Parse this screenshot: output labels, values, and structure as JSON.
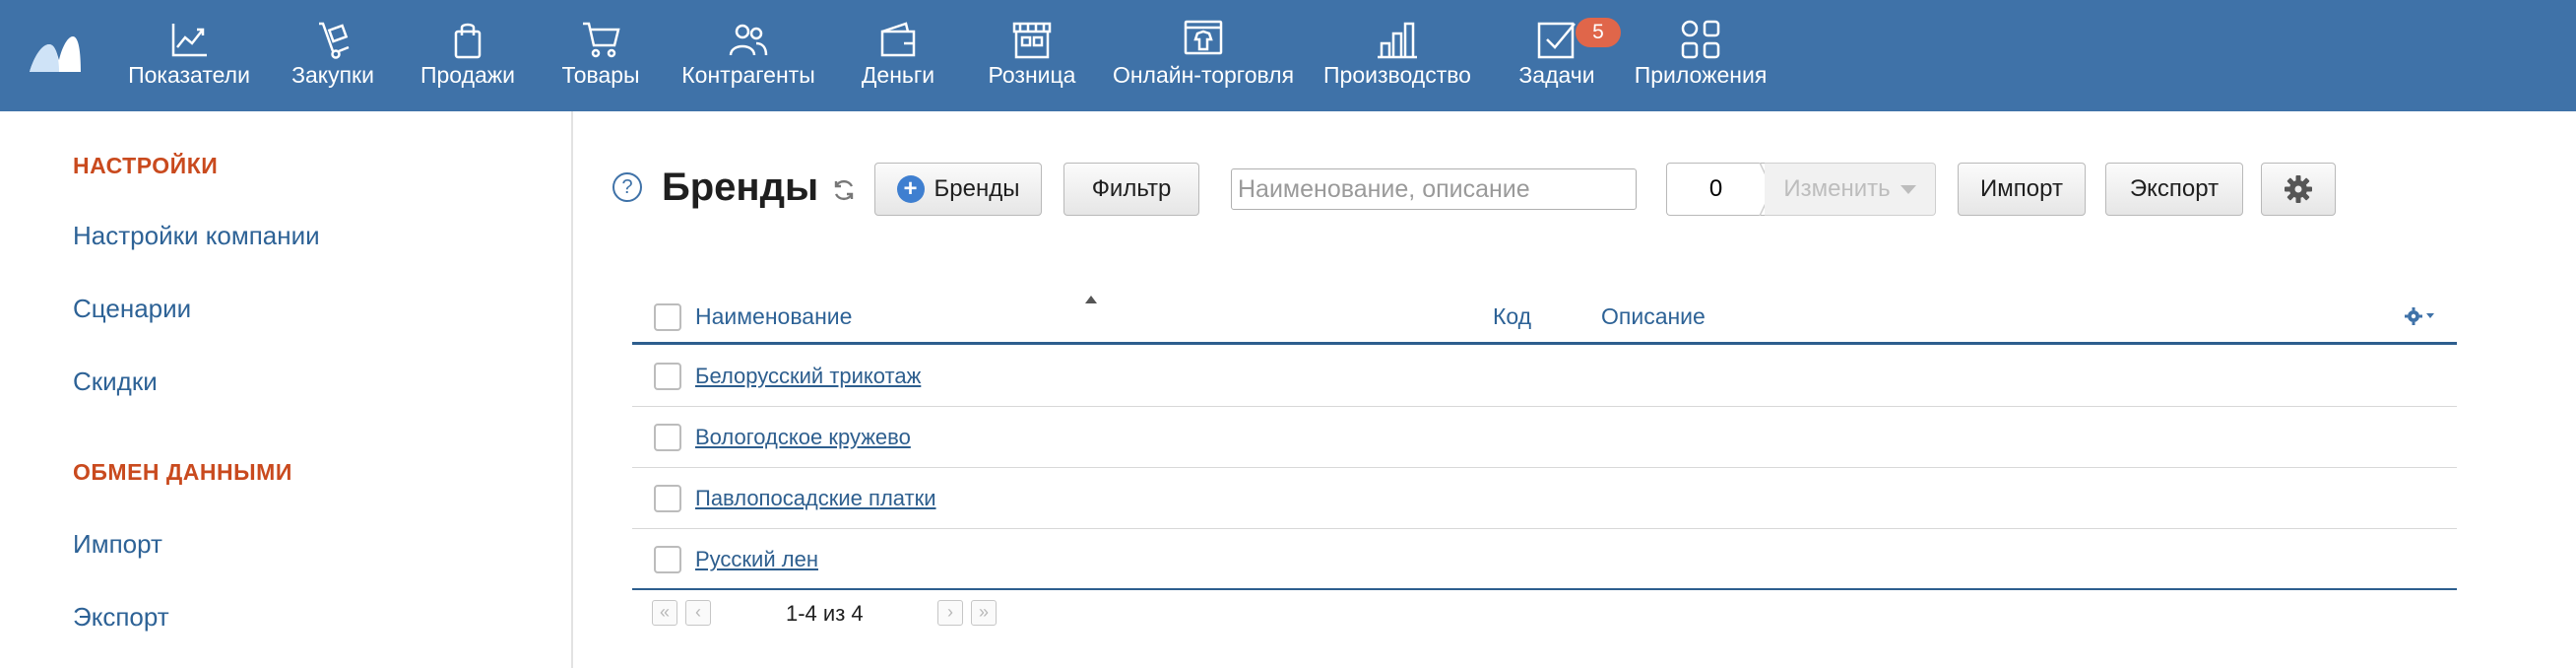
{
  "nav": {
    "items": [
      {
        "label": "Показатели",
        "icon": "chart-line-icon"
      },
      {
        "label": "Закупки",
        "icon": "hand-truck-icon"
      },
      {
        "label": "Продажи",
        "icon": "shopping-bag-icon"
      },
      {
        "label": "Товары",
        "icon": "shopping-cart-icon"
      },
      {
        "label": "Контрагенты",
        "icon": "people-icon"
      },
      {
        "label": "Деньги",
        "icon": "wallet-icon"
      },
      {
        "label": "Розница",
        "icon": "store-icon"
      },
      {
        "label": "Онлайн-торговля",
        "icon": "online-shop-icon"
      },
      {
        "label": "Производство",
        "icon": "factory-icon"
      },
      {
        "label": "Задачи",
        "icon": "task-check-icon",
        "badge": "5"
      },
      {
        "label": "Приложения",
        "icon": "apps-grid-icon"
      }
    ]
  },
  "sidebar": {
    "section1": "НАСТРОЙКИ",
    "links1": [
      "Настройки компании",
      "Сценарии",
      "Скидки"
    ],
    "section2": "ОБМЕН ДАННЫМИ",
    "links2": [
      "Импорт",
      "Экспорт"
    ]
  },
  "toolbar": {
    "help": "?",
    "title": "Бренды",
    "add_label": "Бренды",
    "filter_label": "Фильтр",
    "search_placeholder": "Наименование, описание",
    "selected_count": "0",
    "change_label": "Изменить",
    "import_label": "Импорт",
    "export_label": "Экспорт"
  },
  "table": {
    "columns": [
      "Наименование",
      "Код",
      "Описание"
    ],
    "rows": [
      {
        "name": "Белорусский трикотаж"
      },
      {
        "name": "Вологодское кружево"
      },
      {
        "name": "Павлопосадские платки"
      },
      {
        "name": "Русский лен"
      }
    ]
  },
  "pagination": {
    "text": "1-4 из 4",
    "first": "«",
    "prev": "‹",
    "next": "›",
    "last": "»"
  },
  "colors": {
    "topbar": "#3f72a8",
    "accent_heading": "#c94a1e",
    "link": "#2d6296",
    "badge": "#e0664a"
  }
}
